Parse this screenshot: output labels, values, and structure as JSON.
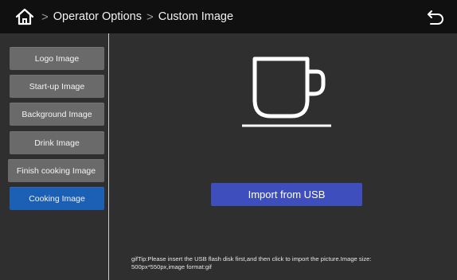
{
  "header": {
    "home_icon": "home-icon",
    "breadcrumb": [
      "Operator Options",
      "Custom Image"
    ],
    "back_icon": "back-arrow-icon"
  },
  "sidebar": {
    "items": [
      {
        "label": "Logo Image",
        "active": false
      },
      {
        "label": "Start-up Image",
        "active": false
      },
      {
        "label": "Background Image",
        "active": false
      },
      {
        "label": "Drink Image",
        "active": false
      },
      {
        "label": "Finish cooking Image",
        "active": false
      },
      {
        "label": "Cooking Image",
        "active": true
      }
    ]
  },
  "main": {
    "preview_icon": "coffee-cup-icon",
    "import_label": "Import from USB",
    "tip_line1": "gifTip:Please insert the USB flash disk first,and then click to import the picture.Image size:",
    "tip_line2": "500px*550px,image format:gif"
  },
  "colors": {
    "header_bg": "#101010",
    "panel_bg": "#2f2f2f",
    "sidebar_button": "#6a6a6a",
    "sidebar_active": "#1c60b6",
    "import_button": "#3e4ebc"
  }
}
